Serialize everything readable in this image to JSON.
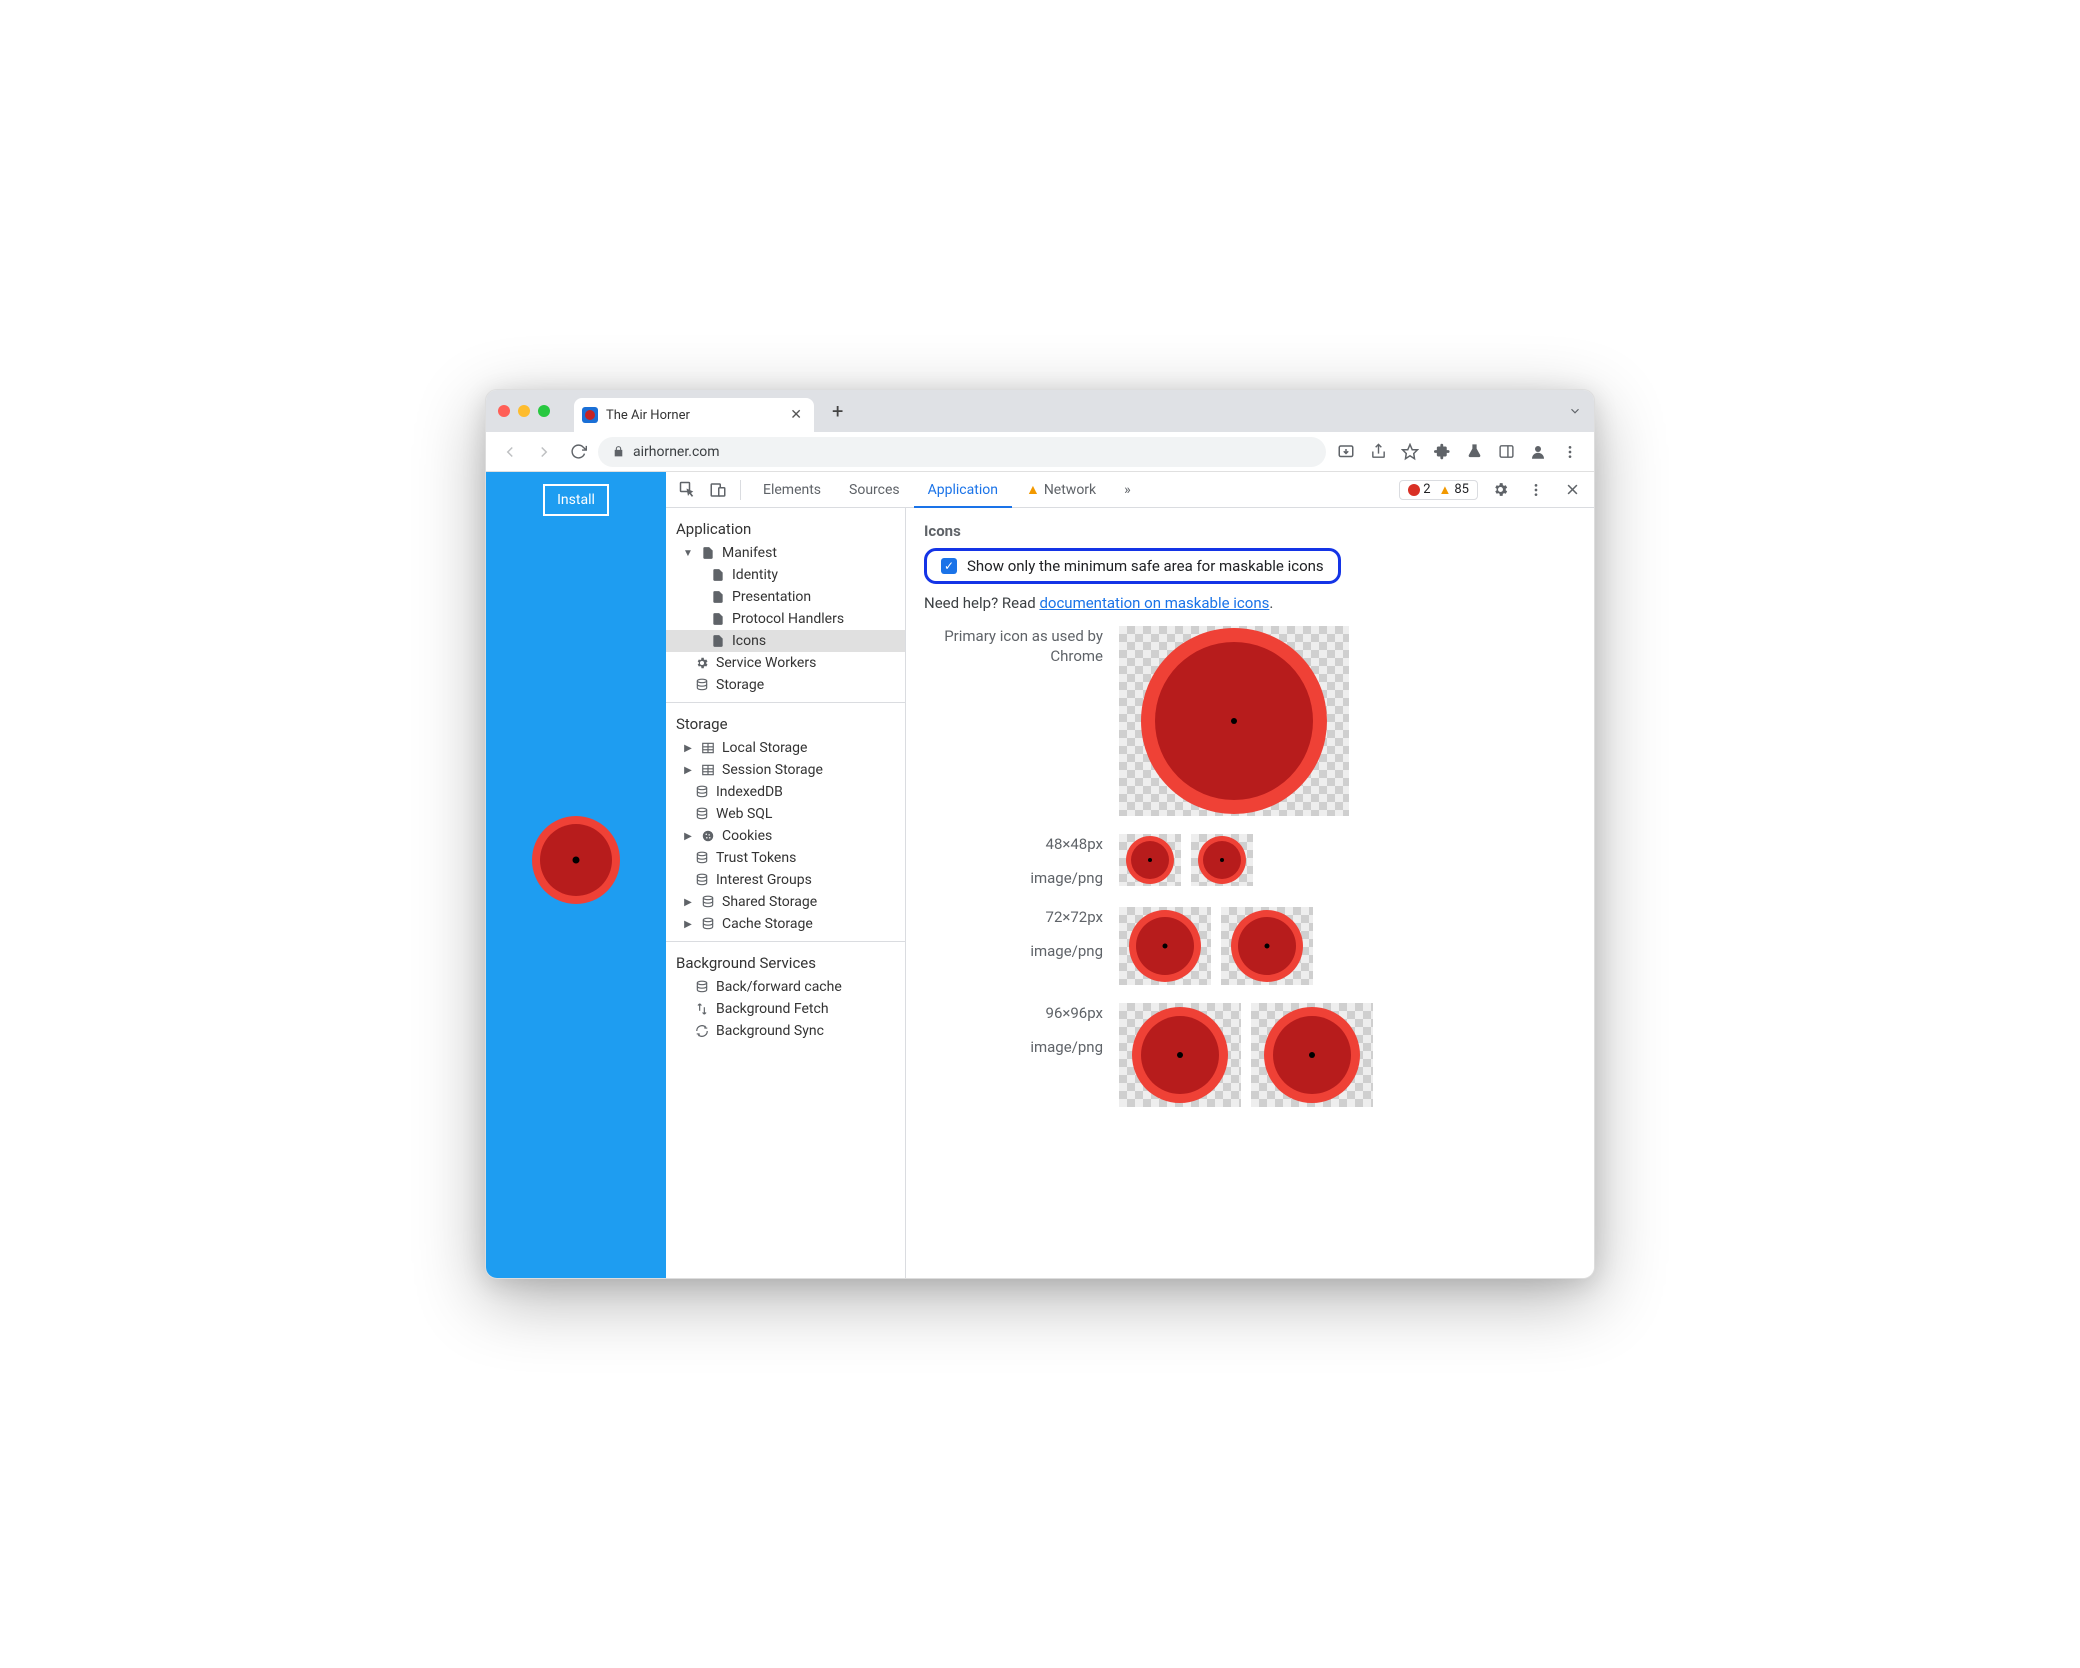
{
  "tab": {
    "title": "The Air Horner"
  },
  "url": {
    "host": "airhorner.com"
  },
  "page": {
    "install": "Install"
  },
  "devtools": {
    "tabs": {
      "elements": "Elements",
      "sources": "Sources",
      "application": "Application",
      "network": "Network"
    },
    "errors": "2",
    "warnings": "85",
    "sidebar": {
      "application": {
        "header": "Application",
        "manifest": "Manifest",
        "identity": "Identity",
        "presentation": "Presentation",
        "protocol": "Protocol Handlers",
        "icons": "Icons",
        "sw": "Service Workers",
        "storage": "Storage"
      },
      "storage": {
        "header": "Storage",
        "local": "Local Storage",
        "session": "Session Storage",
        "indexed": "IndexedDB",
        "websql": "Web SQL",
        "cookies": "Cookies",
        "trust": "Trust Tokens",
        "interest": "Interest Groups",
        "shared": "Shared Storage",
        "cache": "Cache Storage"
      },
      "bg": {
        "header": "Background Services",
        "bf": "Back/forward cache",
        "fetch": "Background Fetch",
        "sync": "Background Sync"
      }
    },
    "main": {
      "title": "Icons",
      "checkbox": "Show only the minimum safe area for maskable icons",
      "help_prefix": "Need help? Read ",
      "help_link": "documentation on maskable icons",
      "help_suffix": ".",
      "primary_label": "Primary icon as used by Chrome",
      "rows": [
        {
          "size": "48×48px",
          "mime": "image/png"
        },
        {
          "size": "72×72px",
          "mime": "image/png"
        },
        {
          "size": "96×96px",
          "mime": "image/png"
        }
      ]
    }
  }
}
